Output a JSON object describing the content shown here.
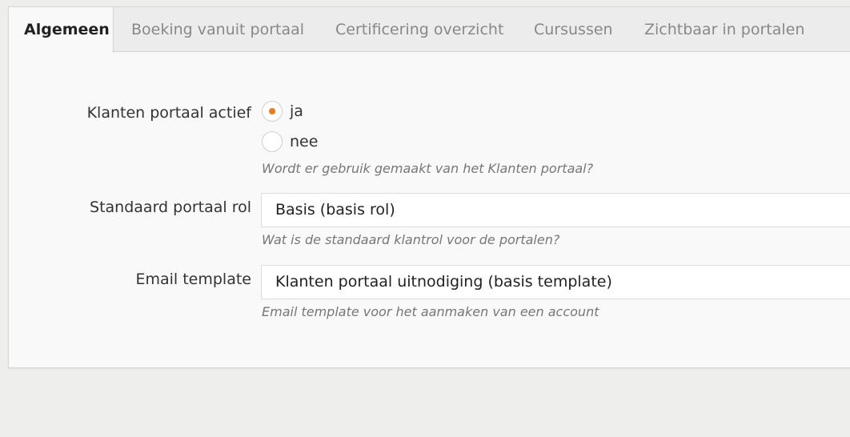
{
  "tabs": [
    {
      "label": "Algemeen",
      "active": true
    },
    {
      "label": "Boeking vanuit portaal",
      "active": false
    },
    {
      "label": "Certificering overzicht",
      "active": false
    },
    {
      "label": "Cursussen",
      "active": false
    },
    {
      "label": "Zichtbaar in portalen",
      "active": false
    }
  ],
  "form": {
    "portal_active": {
      "label": "Klanten portaal actief",
      "options": [
        {
          "label": "ja",
          "selected": true
        },
        {
          "label": "nee",
          "selected": false
        }
      ],
      "help": "Wordt er gebruik gemaakt van het Klanten portaal?"
    },
    "default_role": {
      "label": "Standaard portaal rol",
      "value": "Basis (basis rol)",
      "help": "Wat is de standaard klantrol voor de portalen?"
    },
    "email_template": {
      "label": "Email template",
      "value": "Klanten portaal uitnodiging (basis template)",
      "help": "Email template voor het aanmaken van een account"
    }
  },
  "colors": {
    "accent": "#f07a14",
    "background": "#eeeeec",
    "panel": "#f9f9f9",
    "tabbar": "#ececec"
  }
}
